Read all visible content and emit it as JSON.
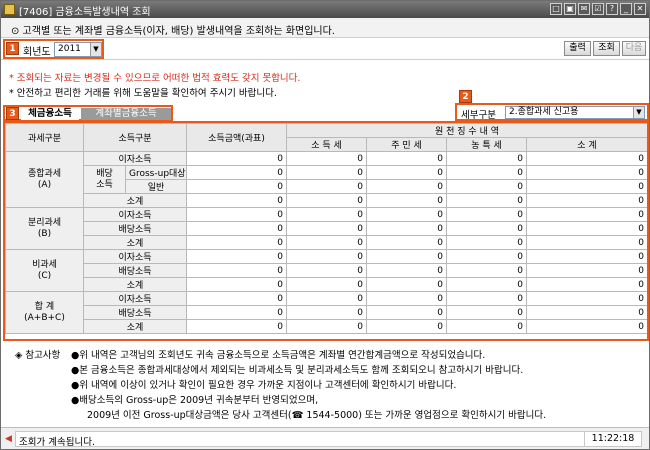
{
  "window": {
    "title": "[7406] 금융소득발생내역 조회",
    "controls": [
      "□",
      "▣",
      "✉",
      "☑",
      "?",
      "_",
      "✕"
    ]
  },
  "info": {
    "text": "⊙ 고객별 또는 계좌별 금융소득(이자, 배당) 발생내역을 조회하는 화면입니다."
  },
  "query": {
    "badge": "1",
    "year_label": "회년도",
    "year_value": "2011",
    "buttons": {
      "print": "출력",
      "search": "조회",
      "next": "다음"
    }
  },
  "notices": {
    "line1": "* 조회되는 자료는 변경될 수 있으므로 어떠한 법적 효력도 갖지 못합니다.",
    "line2": "* 안전하고 편리한 거래를 위해 도움말을 확인하여 주시기 바랍니다."
  },
  "tabs": {
    "badge": "3",
    "items": [
      "체금융소득",
      "계좌별금융소득"
    ]
  },
  "detail": {
    "badge": "2",
    "label": "세부구분",
    "value": "2.종합과세 신고용"
  },
  "table": {
    "headers": {
      "tax_class": "과세구분",
      "income_type": "소득구분",
      "amount": "소득금액(과표)",
      "withholding": "원 천 징 수 내 역",
      "income_tax": "소 득 세",
      "resident_tax": "주 민 세",
      "rural_tax": "농 특 세",
      "total": "소 계"
    },
    "groups": {
      "comprehensive": "종합과세\n(A)",
      "separate": "분리과세\n(B)",
      "non_taxable": "비과세\n(C)",
      "grand_total": "합  계\n(A+B+C)"
    },
    "labels": {
      "interest": "이자소득",
      "dividend": "배당\n소득",
      "grossup": "Gross-up대상",
      "general": "일반",
      "dividend_income": "배당소득",
      "subtotal": "소계"
    },
    "zero": "0"
  },
  "footnotes": {
    "head": "◈ 참고사항",
    "lines": [
      "●위 내역은 고객님의 조회년도 귀속 금융소득으로 소득금액은 계좌별 연간합계금액으로 작성되었습니다.",
      "●본 금융소득은 종합과세대상에서 제외되는 비과세소득 및 분리과세소득도 함께 조회되오니 참고하시기 바랍니다.",
      "●위 내역에 이상이 있거나 확인이 필요한 경우 가까운 지점이나 고객센터에 확인하시기 바랍니다.",
      "●배당소득의 Gross-up은 2009년 귀속분부터 반영되었으며,",
      "2009년 이전 Gross-up대상금액은 당사 고객센터(☎ 1544-5000) 또는 가까운 영업점으로 확인하시기 바랍니다."
    ]
  },
  "status": {
    "message": "조회가 계속됩니다.",
    "time": "11:22:18"
  }
}
